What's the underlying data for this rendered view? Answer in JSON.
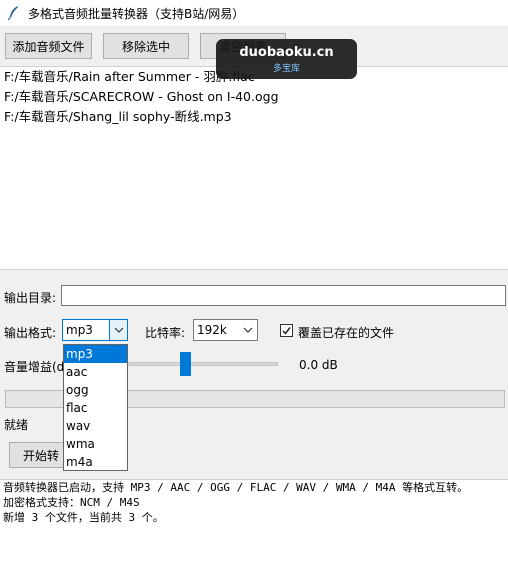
{
  "window": {
    "title": "多格式音频批量转换器（支持B站/网易）"
  },
  "toolbar": {
    "add_label": "添加音频文件",
    "remove_label": "移除选中",
    "third_label": "清空列表"
  },
  "files": [
    "F:/车载音乐/Rain after Summer - 羽肿.flac",
    "F:/车载音乐/SCARECROW - Ghost on I-40.ogg",
    "F:/车载音乐/Shang_lil sophy-断线.mp3"
  ],
  "output": {
    "dir_label": "输出目录:",
    "dir_value": ""
  },
  "format": {
    "label": "输出格式:",
    "value": "mp3",
    "options": [
      "mp3",
      "aac",
      "ogg",
      "flac",
      "wav",
      "wma",
      "m4a"
    ]
  },
  "bitrate": {
    "label": "比特率:",
    "value": "192k"
  },
  "overwrite": {
    "label": "覆盖已存在的文件",
    "checked": true
  },
  "gain": {
    "label": "音量增益(d",
    "value_text": "0.0 dB"
  },
  "progress": {
    "fraction": 0
  },
  "status": {
    "text": "就绪"
  },
  "actions": {
    "start_label": "开始转"
  },
  "log": [
    "音频转换器已启动，支持 MP3 / AAC / OGG / FLAC / WAV / WMA / M4A 等格式互转。",
    "加密格式支持：NCM / M4S",
    "新增 3 个文件，当前共 3 个。"
  ],
  "watermark": {
    "line1": "duobaoku.cn",
    "line2": "多宝库"
  },
  "icons": {
    "app": "feather-icon",
    "dropdown": "chevron-down-icon",
    "check": "checkmark-icon"
  },
  "colors": {
    "accent": "#0078d7",
    "button_bg": "#e1e1e1"
  }
}
